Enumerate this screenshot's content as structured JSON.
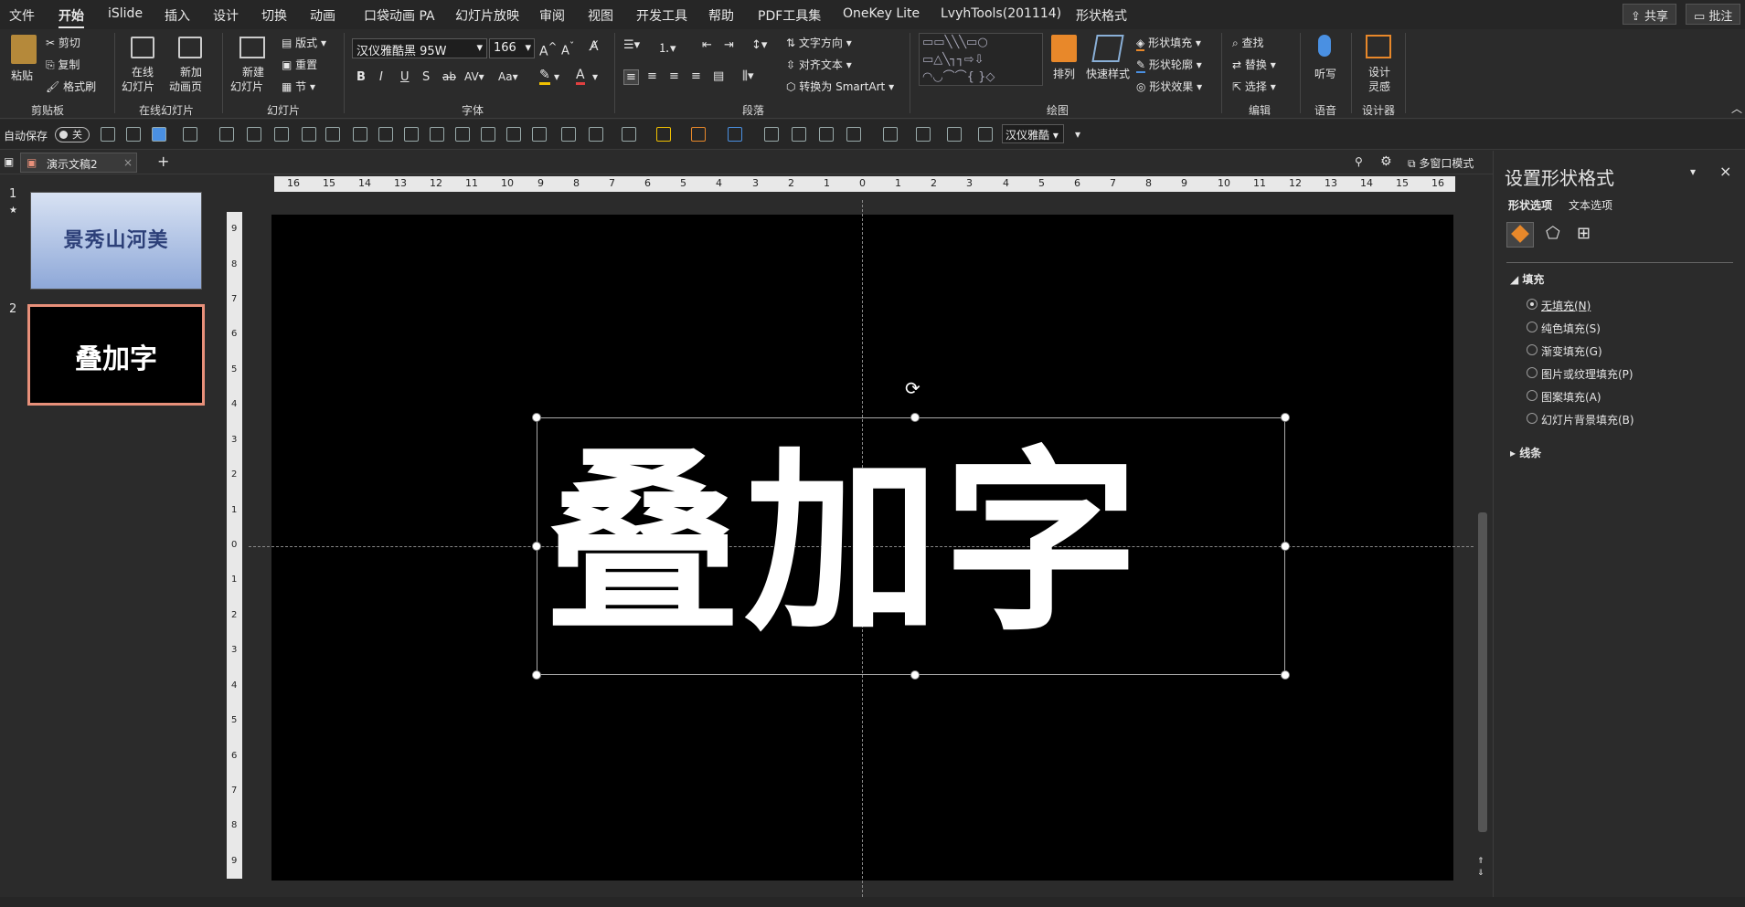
{
  "menubar": {
    "tabs": [
      "文件",
      "开始",
      "iSlide",
      "插入",
      "设计",
      "切换",
      "动画",
      "口袋动画 PA",
      "幻灯片放映",
      "审阅",
      "视图",
      "开发工具",
      "帮助",
      "PDF工具集",
      "OneKey Lite",
      "LvyhTools(201114)",
      "形状格式"
    ],
    "share": "共享",
    "comments": "批注"
  },
  "ribbon": {
    "clipboard": {
      "paste": "粘贴",
      "cut": "剪切",
      "copy": "复制",
      "format_painter": "格式刷",
      "label": "剪贴板"
    },
    "online_slides": {
      "online": "在线",
      "online2": "幻灯片",
      "new_anim": "新加",
      "new_anim2": "动画页",
      "label": "在线幻灯片"
    },
    "slides": {
      "new": "新建",
      "new2": "幻灯片",
      "layout": "版式",
      "reset": "重置",
      "section": "节",
      "label": "幻灯片"
    },
    "font": {
      "name": "汉仪雅酷黑 95W",
      "size": "166",
      "label": "字体"
    },
    "paragraph": {
      "text_direction": "文字方向",
      "align_text": "对齐文本",
      "smartart": "转换为 SmartArt",
      "label": "段落"
    },
    "drawing": {
      "arrange": "排列",
      "quick_styles": "快速样式",
      "shape_fill": "形状填充",
      "shape_outline": "形状轮廓",
      "shape_effects": "形状效果",
      "label": "绘图"
    },
    "editing": {
      "find": "查找",
      "replace": "替换",
      "select": "选择",
      "label": "编辑"
    },
    "voice": {
      "dictate": "听写",
      "label": "语音"
    },
    "designer": {
      "design": "设计",
      "design2": "灵感",
      "label": "设计器"
    }
  },
  "qat": {
    "autosave": "自动保存",
    "autosave_state": "关",
    "font_box": "汉仪雅酷"
  },
  "tabstrip": {
    "doc_title": "演示文稿2",
    "multi_window": "多窗口模式"
  },
  "thumbnails": [
    {
      "number": "1",
      "text": "景秀山河美",
      "star": "★"
    },
    {
      "number": "2",
      "text": "叠加字"
    }
  ],
  "ruler_h_ticks": [
    "16",
    "15",
    "14",
    "13",
    "12",
    "11",
    "10",
    "9",
    "8",
    "7",
    "6",
    "5",
    "4",
    "3",
    "2",
    "1",
    "0",
    "1",
    "2",
    "3",
    "4",
    "5",
    "6",
    "7",
    "8",
    "9",
    "10",
    "11",
    "12",
    "13",
    "14",
    "15",
    "16"
  ],
  "ruler_v_ticks": [
    "9",
    "8",
    "7",
    "6",
    "5",
    "4",
    "3",
    "2",
    "1",
    "0",
    "1",
    "2",
    "3",
    "4",
    "5",
    "6",
    "7",
    "8",
    "9"
  ],
  "slide": {
    "text": "叠加字"
  },
  "panel": {
    "title": "设置形状格式",
    "tab_shape": "形状选项",
    "tab_text": "文本选项",
    "fill_section": "填充",
    "options": [
      "无填充(N)",
      "纯色填充(S)",
      "渐变填充(G)",
      "图片或纹理填充(P)",
      "图案填充(A)",
      "幻灯片背景填充(B)"
    ],
    "selected_index": 0,
    "line_section": "线条"
  },
  "colors": {
    "accent": "#e8907a",
    "slide_bg": "#000000",
    "text": "#ffffff"
  }
}
